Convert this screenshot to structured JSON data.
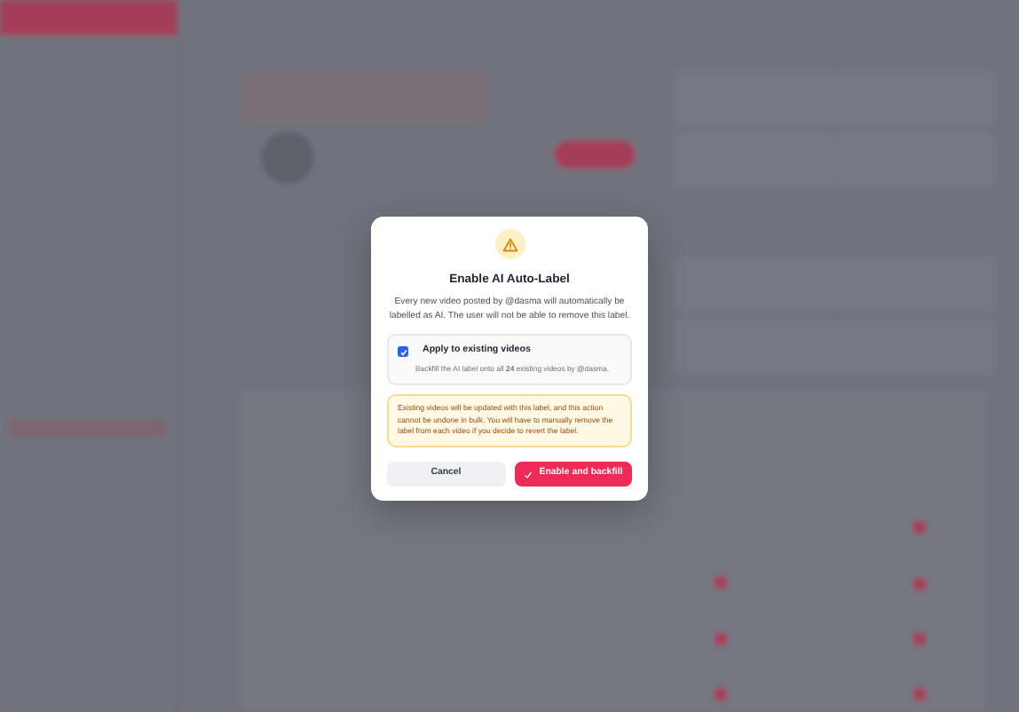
{
  "dialog": {
    "title": "Enable AI Auto-Label",
    "message": "Every new video posted by @dasma will automatically be labelled as AI. The user will not be able to remove this label.",
    "option": {
      "label": "Apply to existing videos",
      "checked": true,
      "description": "Backfill the AI label onto all **24** existing videos by @dasma."
    },
    "warning": "Existing videos will be updated with this label, and this action cannot be undone in bulk. You will have to manually remove the label from each video if you decide to revert the label.",
    "buttons": [
      {
        "label": "Cancel",
        "kind": "secondary"
      },
      {
        "label": "Enable and backfill",
        "kind": "primary"
      }
    ]
  }
}
